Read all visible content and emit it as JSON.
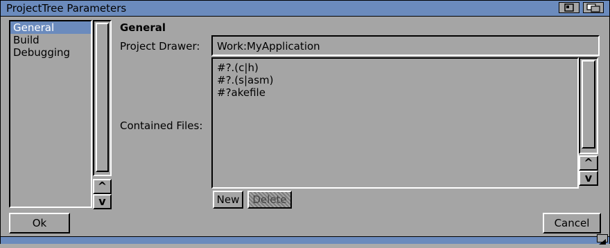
{
  "window": {
    "title": "ProjectTree Parameters"
  },
  "sections": {
    "items": [
      "General",
      "Build",
      "Debugging"
    ],
    "selected": 0
  },
  "general": {
    "heading": "General",
    "project_drawer_label": "Project Drawer:",
    "project_drawer_value": "Work:MyApplication",
    "contained_files_label": "Contained Files:",
    "contained_files": [
      "#?.(c|h)",
      "#?.(s|asm)",
      "#?akefile"
    ],
    "new_label": "New",
    "delete_label": "Delete"
  },
  "footer": {
    "ok_label": "Ok",
    "cancel_label": "Cancel"
  },
  "icons": {
    "scroll_up": "^",
    "scroll_down": "v"
  }
}
